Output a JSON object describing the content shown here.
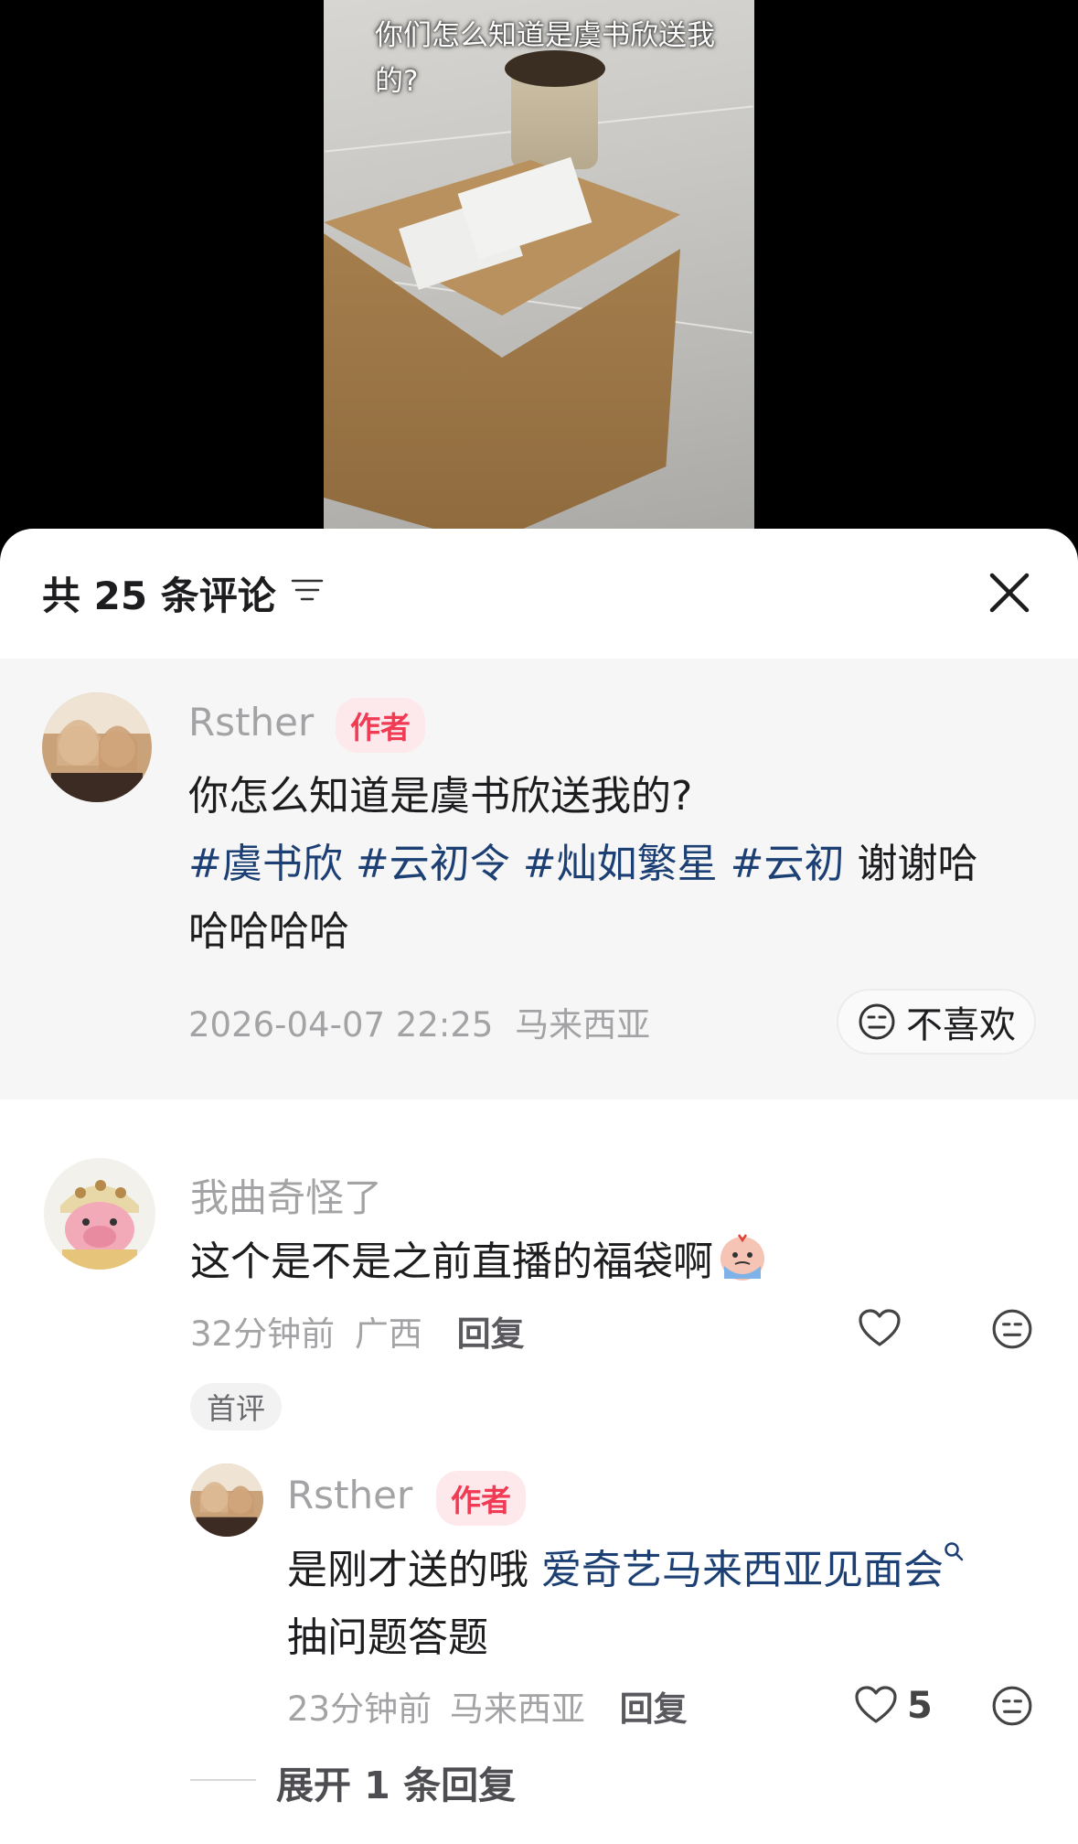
{
  "video": {
    "caption": "你们怎么知道是虞书欣送我的?"
  },
  "comments_sheet": {
    "title": "共 25 条评论",
    "close_label": "close"
  },
  "pinned_comment": {
    "username": "Rsther",
    "author_tag": "作者",
    "text_line1": "你怎么知道是虞书欣送我的?",
    "hashtags": [
      "#虞书欣",
      "#云初令",
      "#灿如繁星",
      "#云初"
    ],
    "text_tail": "谢谢哈",
    "text_line3": "哈哈哈哈",
    "timestamp": "2026-04-07 22:25",
    "location": "马来西亚",
    "dislike_label": "不喜欢"
  },
  "comment": {
    "username": "我曲奇怪了",
    "text": "这个是不是之前直播的福袋啊",
    "time": "32分钟前",
    "location": "广西",
    "reply_label": "回复",
    "first_tag": "首评"
  },
  "reply": {
    "username": "Rsther",
    "author_tag": "作者",
    "text_start": "是刚才送的哦",
    "link_text": "爱奇艺马来西亚见面会",
    "text_line2": "抽问题答题",
    "time": "23分钟前",
    "location": "马来西亚",
    "reply_label": "回复",
    "likes": "5"
  },
  "expand": {
    "label": "展开 1 条回复"
  },
  "colors": {
    "author_tag": "#f13b55",
    "hashtag": "#1c3f74",
    "muted": "#a3a3a6"
  }
}
